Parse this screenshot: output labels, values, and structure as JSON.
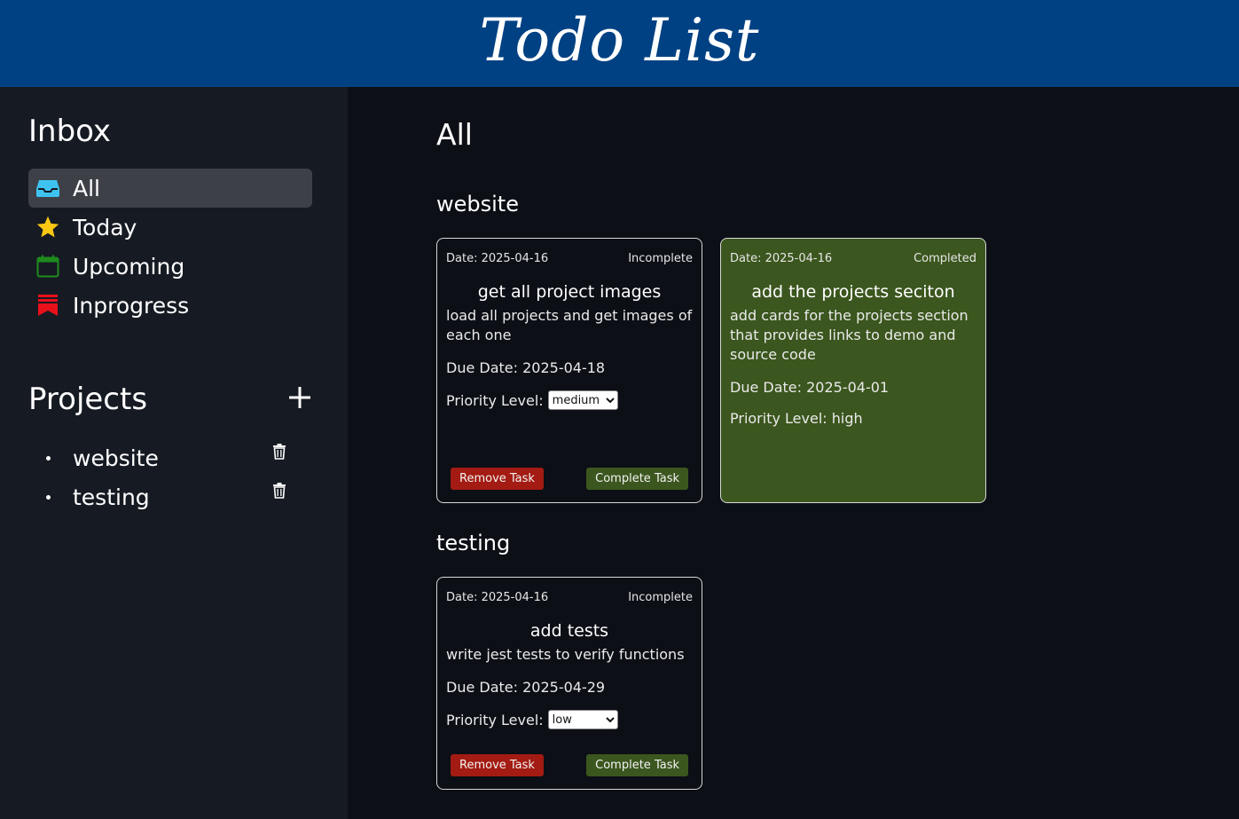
{
  "header": {
    "title": "Todo List"
  },
  "sidebar": {
    "inbox_title": "Inbox",
    "nav": [
      {
        "label": "All",
        "icon": "inbox-icon",
        "active": true
      },
      {
        "label": "Today",
        "icon": "star-icon",
        "active": false
      },
      {
        "label": "Upcoming",
        "icon": "calendar-icon",
        "active": false
      },
      {
        "label": "Inprogress",
        "icon": "bookmark-icon",
        "active": false
      }
    ],
    "projects_title": "Projects",
    "projects": [
      {
        "label": "website"
      },
      {
        "label": "testing"
      }
    ]
  },
  "main": {
    "title": "All",
    "sections": [
      {
        "name": "website",
        "tasks": [
          {
            "date": "Date: 2025-04-16",
            "status": "Incomplete",
            "title": "get all project images",
            "description": "load all projects and get images of each one",
            "due": "Due Date: 2025-04-18",
            "priority_label": "Priority Level:",
            "priority": "medium",
            "remove_label": "Remove Task",
            "complete_label": "Complete Task"
          },
          {
            "date": "Date: 2025-04-16",
            "status": "Completed",
            "title": "add the projects seciton",
            "description": "add cards for the projects section that provides links to demo and source code",
            "due": "Due Date: 2025-04-01",
            "priority_text": "Priority Level: high"
          }
        ]
      },
      {
        "name": "testing",
        "tasks": [
          {
            "date": "Date: 2025-04-16",
            "status": "Incomplete",
            "title": "add tests",
            "description": "write jest tests to verify functions",
            "due": "Due Date: 2025-04-29",
            "priority_label": "Priority Level:",
            "priority": "low",
            "remove_label": "Remove Task",
            "complete_label": "Complete Task"
          }
        ]
      }
    ]
  },
  "colors": {
    "header_bg": "#004183",
    "sidebar_bg": "#161a22",
    "main_bg": "#0c0f16",
    "completed_card": "#3b561e",
    "remove_button": "#a31b12",
    "complete_button": "#3b561e"
  }
}
